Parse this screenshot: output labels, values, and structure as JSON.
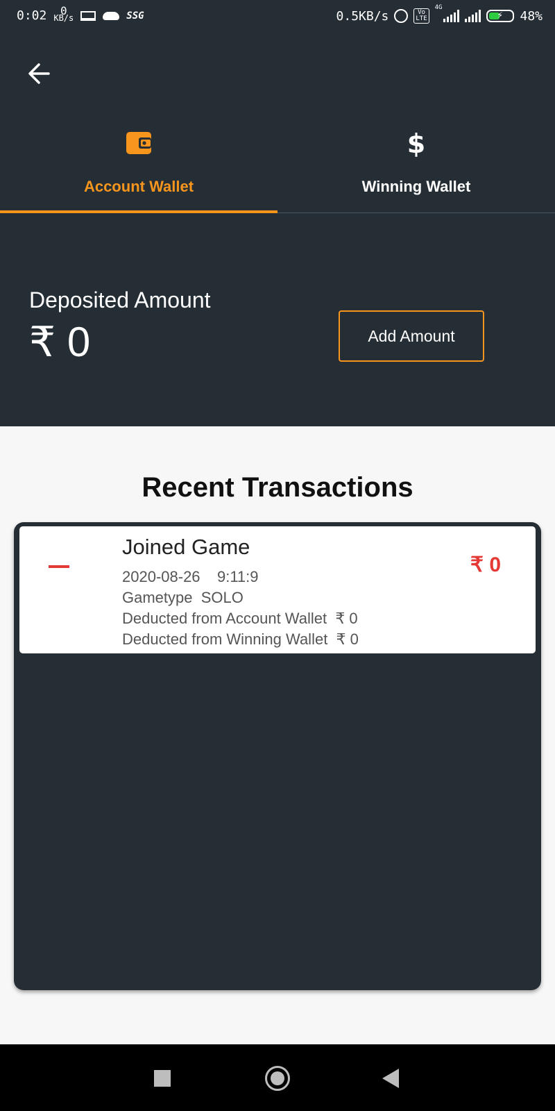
{
  "status_bar": {
    "time": "0:02",
    "kbs_value": "0",
    "kbs_unit": "KB/s",
    "carrier": "SSG",
    "net_speed": "0.5KB/s",
    "volte_top": "Vo",
    "volte_bottom": "LTE",
    "network_type": "4G",
    "battery_percent": "48%",
    "battery_level": 0.48
  },
  "tabs": [
    {
      "label": "Account Wallet",
      "icon": "wallet-icon",
      "active": true
    },
    {
      "label": "Winning Wallet",
      "icon": "dollar-icon",
      "active": false
    }
  ],
  "colors": {
    "accent": "#f8951d",
    "panel_dark": "#262e35",
    "negative": "#e53935"
  },
  "wallet": {
    "deposited_label": "Deposited Amount",
    "deposited_amount": "₹ 0",
    "add_amount_label": "Add Amount"
  },
  "recent": {
    "title": "Recent Transactions",
    "items": [
      {
        "title": "Joined Game",
        "datetime": "2020-08-26    9:11:9",
        "gametype": "Gametype  SOLO",
        "deduct_account": "Deducted from Account Wallet  ₹ 0",
        "deduct_winning": "Deducted from Winning Wallet  ₹ 0",
        "amount": "₹ 0"
      }
    ]
  }
}
